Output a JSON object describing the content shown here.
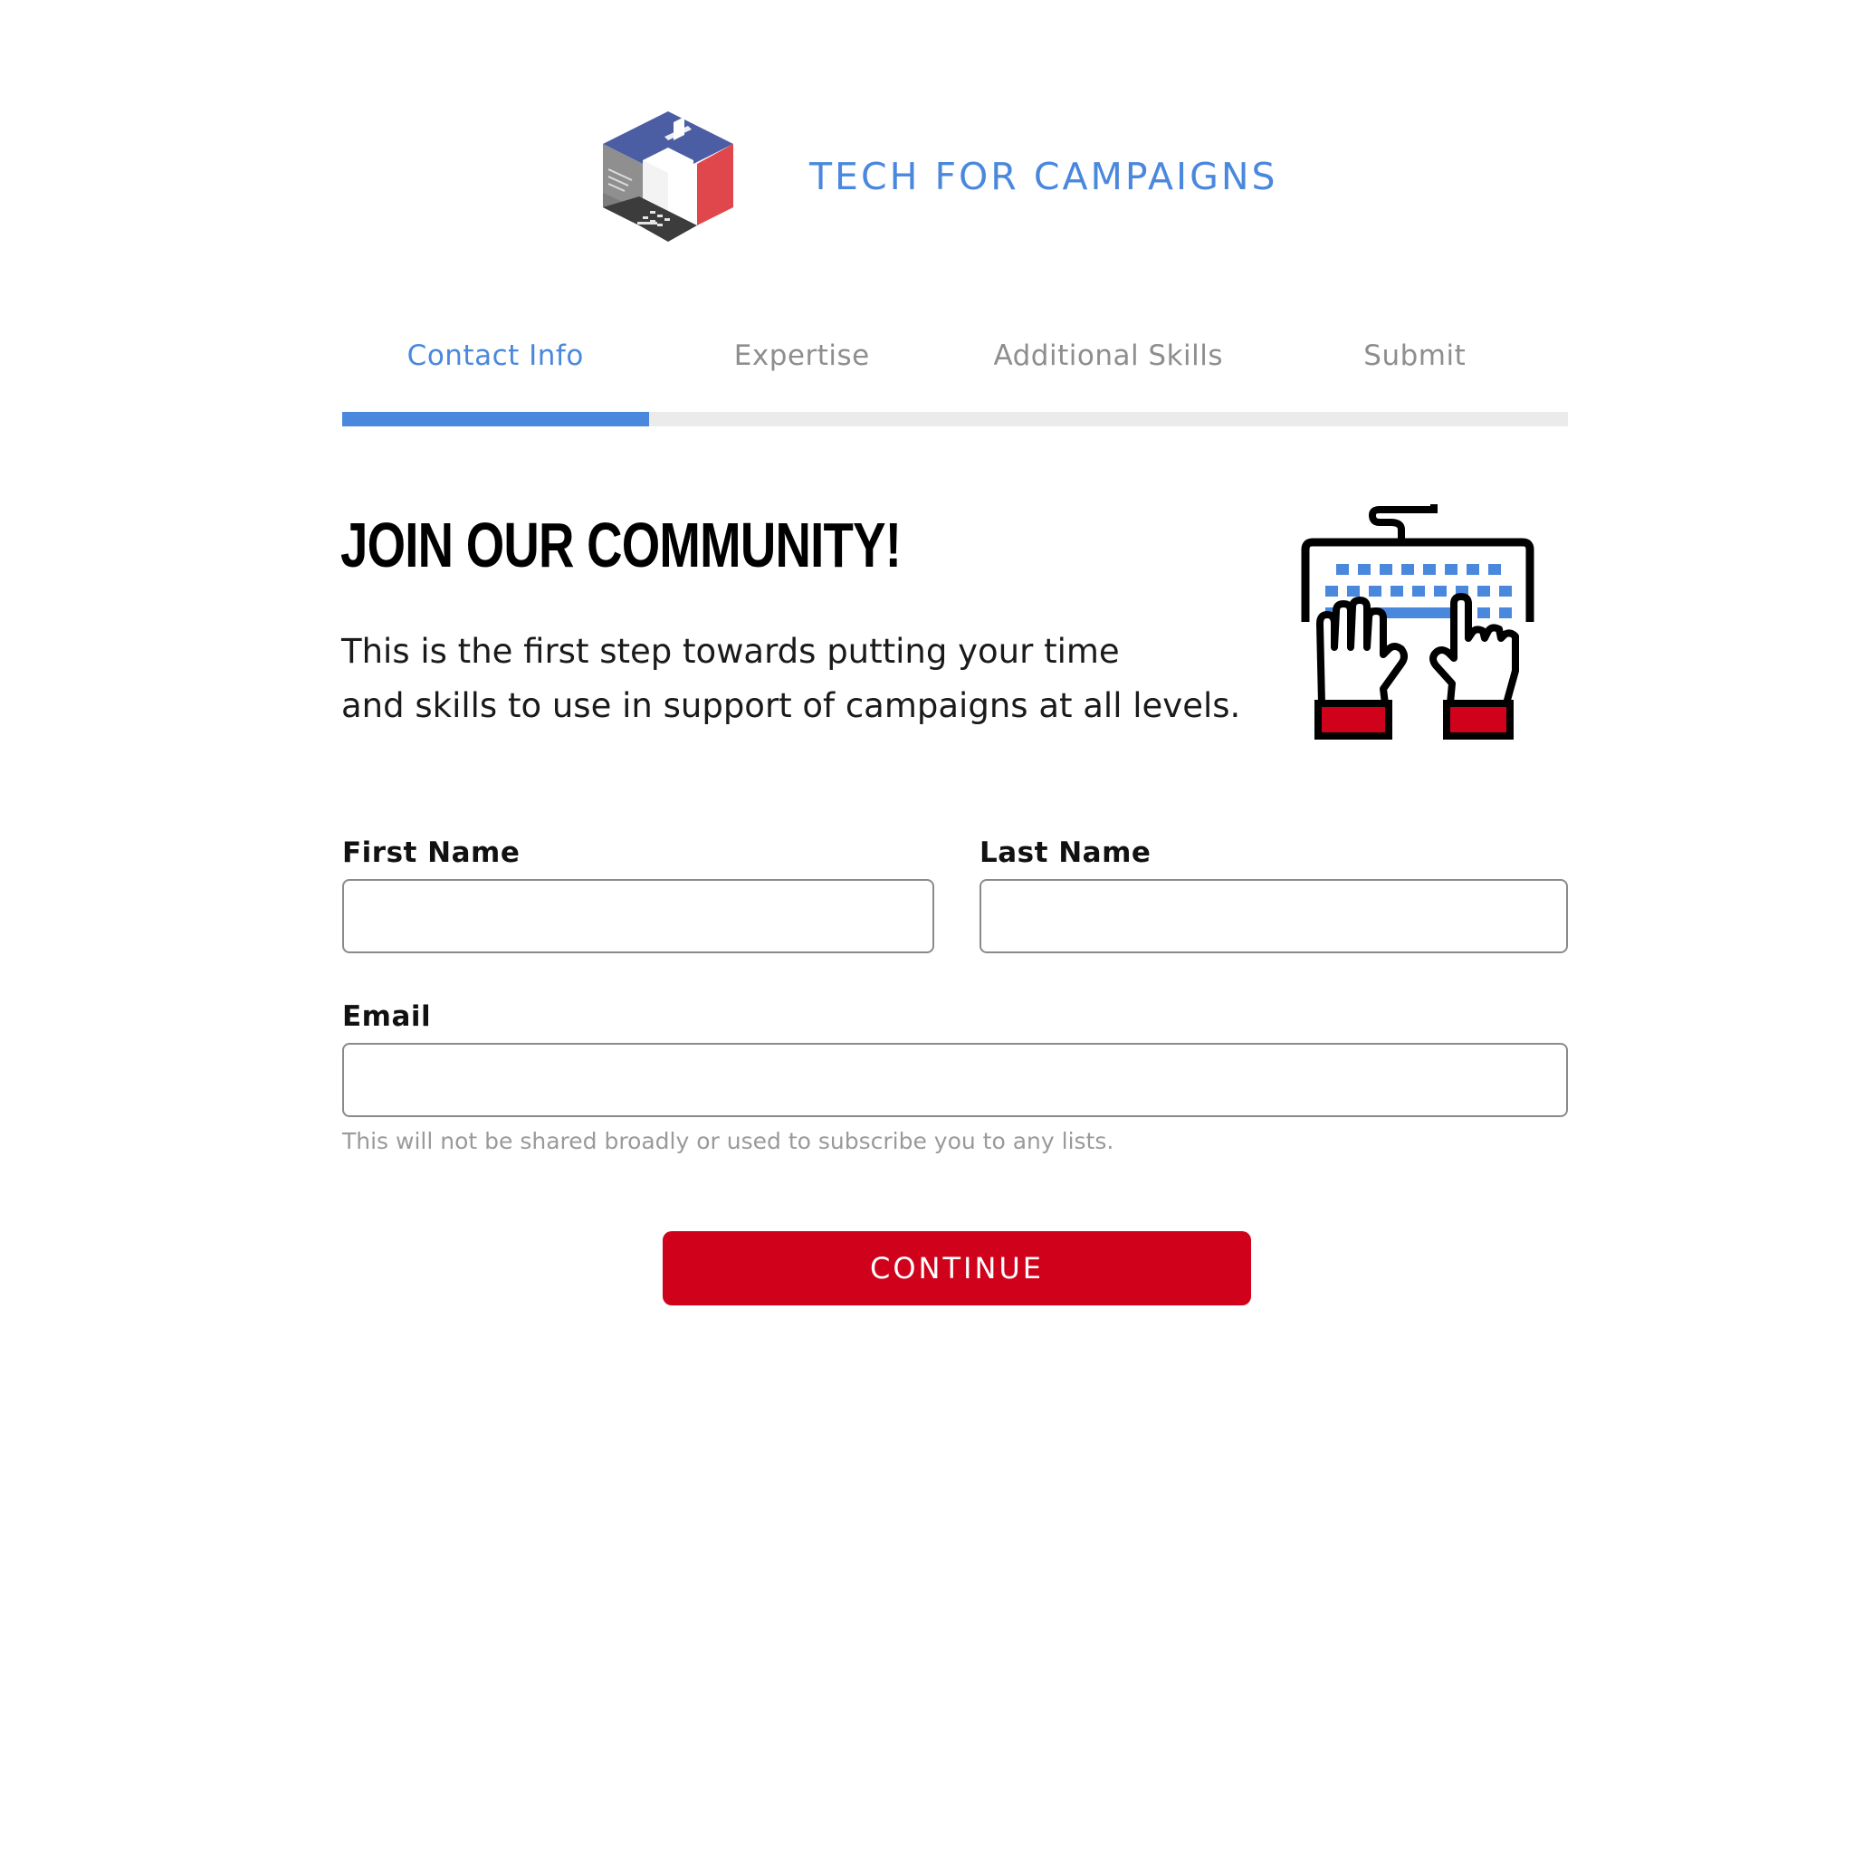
{
  "brand": {
    "name": "TECH FOR CAMPAIGNS",
    "logo_icon": "cube-laptop-ballot-icon",
    "color": "#4a88dd"
  },
  "steps": {
    "items": [
      {
        "label": "Contact Info",
        "active": true
      },
      {
        "label": "Expertise",
        "active": false
      },
      {
        "label": "Additional Skills",
        "active": false
      },
      {
        "label": "Submit",
        "active": false
      }
    ],
    "progress": 0.25
  },
  "hero": {
    "title": "JOIN OUR COMMUNITY!",
    "intro_line1": "This is the first step towards putting your time",
    "intro_line2": "and skills to use in support of campaigns at all levels.",
    "illustration_icon": "hands-typing-keyboard-icon"
  },
  "form": {
    "first_name": {
      "label": "First Name",
      "value": "",
      "placeholder": ""
    },
    "last_name": {
      "label": "Last Name",
      "value": "",
      "placeholder": ""
    },
    "email": {
      "label": "Email",
      "value": "",
      "placeholder": "",
      "help": "This will not be shared broadly or used to subscribe you to any lists."
    },
    "continue_label": "CONTINUE"
  },
  "colors": {
    "accent_blue": "#4a88dd",
    "button_red": "#d0021b",
    "track_gray": "#ebebeb"
  }
}
